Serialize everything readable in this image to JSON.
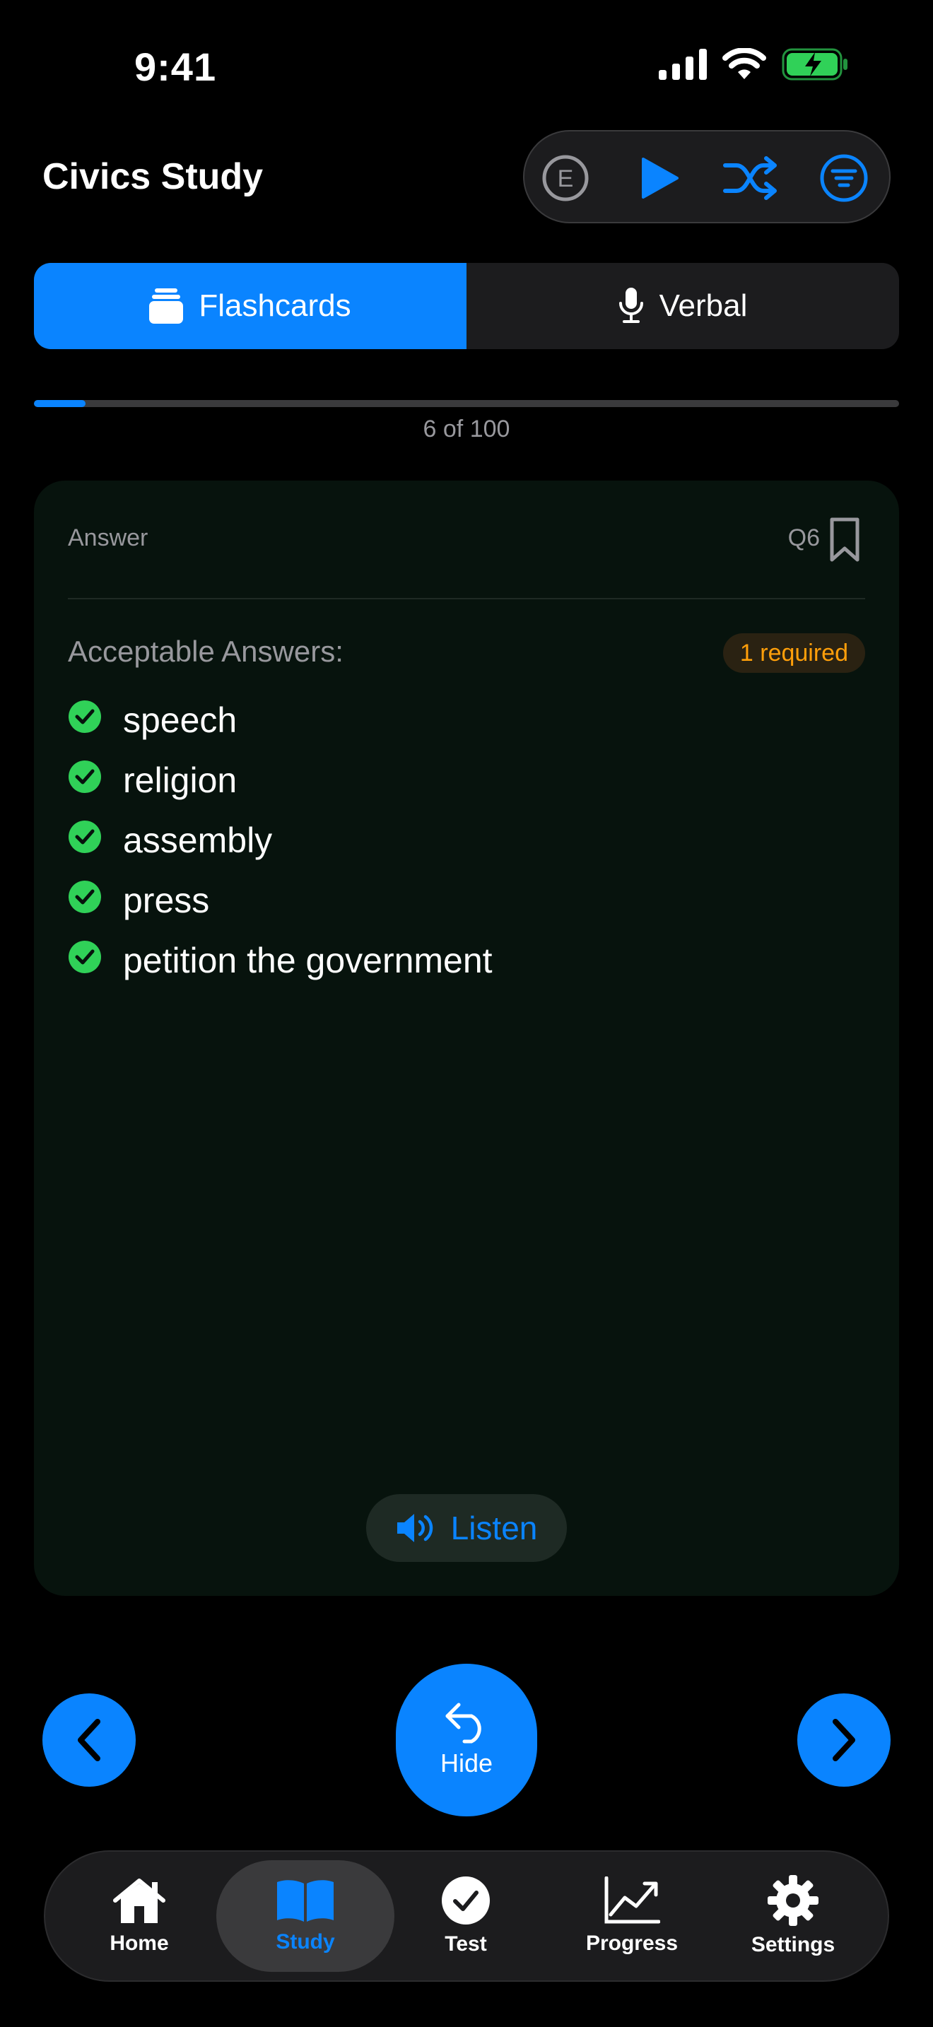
{
  "status_bar": {
    "time": "9:41"
  },
  "header": {
    "title": "Civics Study"
  },
  "toolbar": {
    "english_icon_letter": "E",
    "accent": "#0a84ff"
  },
  "segments": [
    {
      "label": "Flashcards",
      "icon": "cards-icon",
      "active": true
    },
    {
      "label": "Verbal",
      "icon": "microphone-icon",
      "active": false
    }
  ],
  "progress": {
    "current": 6,
    "total": 100,
    "text": "6 of 100"
  },
  "card": {
    "side_label": "Answer",
    "question_number": "Q6",
    "acceptable_title": "Acceptable Answers:",
    "required_badge": "1 required",
    "answers": [
      "speech",
      "religion",
      "assembly",
      "press",
      "petition the government"
    ],
    "listen_label": "Listen"
  },
  "controls": {
    "hide_label": "Hide"
  },
  "tabbar": {
    "items": [
      {
        "label": "Home",
        "icon": "house-icon",
        "active": false
      },
      {
        "label": "Study",
        "icon": "book-icon",
        "active": true
      },
      {
        "label": "Test",
        "icon": "checkmark-circle-icon",
        "active": false
      },
      {
        "label": "Progress",
        "icon": "chart-line-icon",
        "active": false
      },
      {
        "label": "Settings",
        "icon": "gear-icon",
        "active": false
      }
    ]
  },
  "colors": {
    "accent": "#0a84ff",
    "success": "#30d158",
    "warning": "#ff9f0a",
    "card_bg": "#07130d"
  }
}
